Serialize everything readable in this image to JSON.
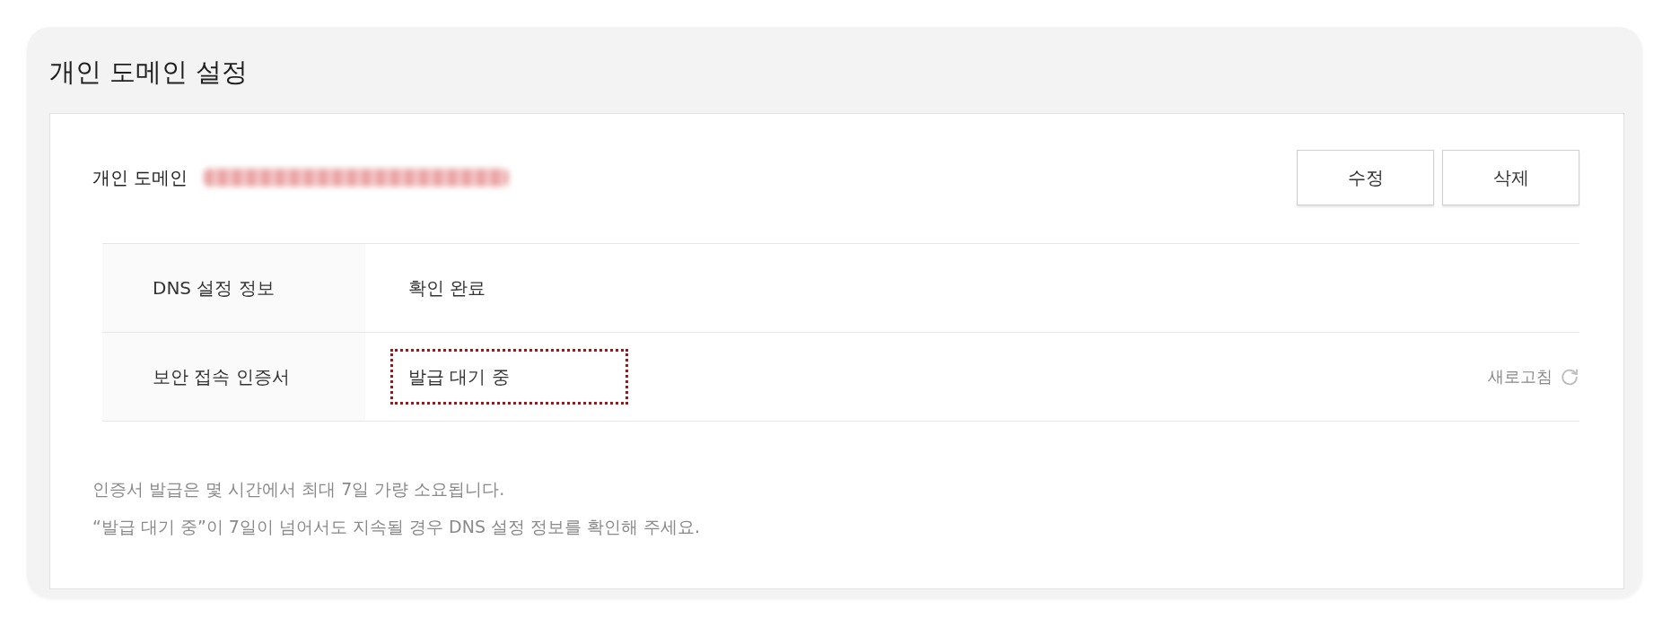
{
  "panel": {
    "title": "개인 도메인 설정"
  },
  "domain": {
    "label": "개인 도메인",
    "redacted": true
  },
  "buttons": [
    {
      "label": "수정"
    },
    {
      "label": "삭제"
    }
  ],
  "table": {
    "rows": [
      {
        "label": "DNS 설정 정보",
        "value": "확인 완료",
        "highlighted": false
      },
      {
        "label": "보안 접속 인증서",
        "value": "발급 대기 중",
        "highlighted": true,
        "action": "새로고침"
      }
    ]
  },
  "notes": [
    "인증서 발급은 몇 시간에서 최대 7일 가량 소요됩니다.",
    "“발급 대기 중”이 7일이 넘어서도 지속될 경우 DNS 설정 정보를 확인해 주세요."
  ]
}
